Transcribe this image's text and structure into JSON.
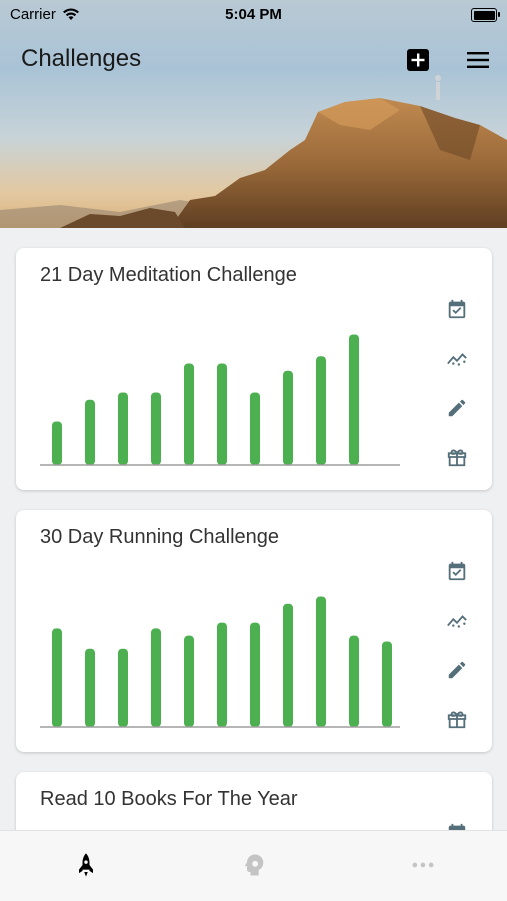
{
  "status_bar": {
    "carrier": "Carrier",
    "time": "5:04 PM"
  },
  "header": {
    "title": "Challenges",
    "add_icon": "add-box-icon",
    "menu_icon": "hamburger-menu-icon"
  },
  "colors": {
    "bar": "#4caf50",
    "icon": "#546e7a",
    "axis": "#9e9e9e"
  },
  "cards": [
    {
      "title": "21 Day Meditation Challenge",
      "chart_data": {
        "type": "bar",
        "values": [
          3,
          4.5,
          5,
          5,
          7,
          7,
          5,
          6.5,
          7.5,
          9
        ],
        "ylim": [
          0,
          10
        ]
      },
      "actions": [
        "calendar-check-icon",
        "progress-graph-icon",
        "edit-icon",
        "gift-icon"
      ]
    },
    {
      "title": "30 Day Running Challenge",
      "chart_data": {
        "type": "bar",
        "values": [
          6.8,
          5.4,
          5.4,
          6.8,
          6.3,
          7.2,
          7.2,
          8.5,
          9,
          6.3,
          5.9
        ],
        "ylim": [
          0,
          10
        ]
      },
      "actions": [
        "calendar-check-icon",
        "progress-graph-icon",
        "edit-icon",
        "gift-icon"
      ]
    },
    {
      "title": "Read 10 Books For The Year",
      "actions": [
        "calendar-check-icon"
      ]
    }
  ],
  "tabs": [
    {
      "icon": "rocket-icon",
      "active": true
    },
    {
      "icon": "brain-gear-icon",
      "active": false
    },
    {
      "icon": "more-dots-icon",
      "active": false
    }
  ]
}
